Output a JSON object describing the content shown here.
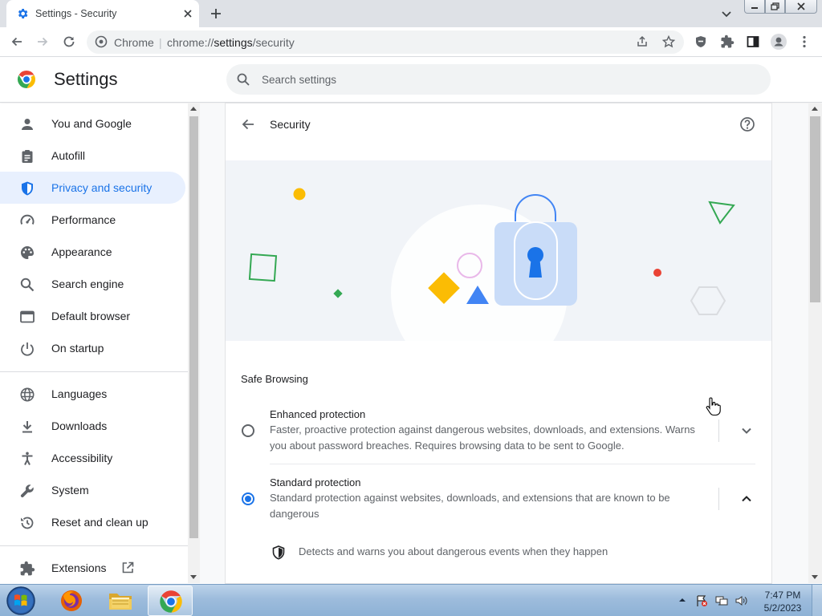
{
  "browser": {
    "tab_title": "Settings - Security",
    "omnibox_prefix": "Chrome",
    "omnibox_separator": "|",
    "omnibox_url_scheme": "chrome://",
    "omnibox_url_host": "settings",
    "omnibox_url_path": "/security"
  },
  "header": {
    "title": "Settings",
    "search_placeholder": "Search settings"
  },
  "sidebar": {
    "items": [
      {
        "label": "You and Google",
        "icon": "person-icon"
      },
      {
        "label": "Autofill",
        "icon": "clipboard-icon"
      },
      {
        "label": "Privacy and security",
        "icon": "shield-icon",
        "active": true
      },
      {
        "label": "Performance",
        "icon": "gauge-icon"
      },
      {
        "label": "Appearance",
        "icon": "palette-icon"
      },
      {
        "label": "Search engine",
        "icon": "search-icon"
      },
      {
        "label": "Default browser",
        "icon": "browser-window-icon"
      },
      {
        "label": "On startup",
        "icon": "power-icon"
      },
      {
        "label": "Languages",
        "icon": "globe-icon"
      },
      {
        "label": "Downloads",
        "icon": "download-icon"
      },
      {
        "label": "Accessibility",
        "icon": "accessibility-icon"
      },
      {
        "label": "System",
        "icon": "wrench-icon"
      },
      {
        "label": "Reset and clean up",
        "icon": "history-icon"
      },
      {
        "label": "Extensions",
        "icon": "puzzle-icon"
      }
    ]
  },
  "main": {
    "page_title": "Security",
    "section_title": "Safe Browsing",
    "options": [
      {
        "title": "Enhanced protection",
        "desc_line1": "Faster, proactive protection against dangerous websites, downloads, and extensions. Warns",
        "desc_line2": "you about password breaches. Requires browsing data to be sent to Google.",
        "selected": false
      },
      {
        "title": "Standard protection",
        "desc_line1": "Standard protection against websites, downloads, and extensions that are known to be",
        "desc_line2": "dangerous",
        "selected": true
      }
    ],
    "detail_text": "Detects and warns you about dangerous events when they happen"
  },
  "taskbar": {
    "time": "7:47 PM",
    "date": "5/2/2023"
  },
  "colors": {
    "accent": "#1a73e8",
    "active_nav_bg": "#e8f0fe",
    "text_primary": "#202124",
    "text_secondary": "#5f6368"
  }
}
